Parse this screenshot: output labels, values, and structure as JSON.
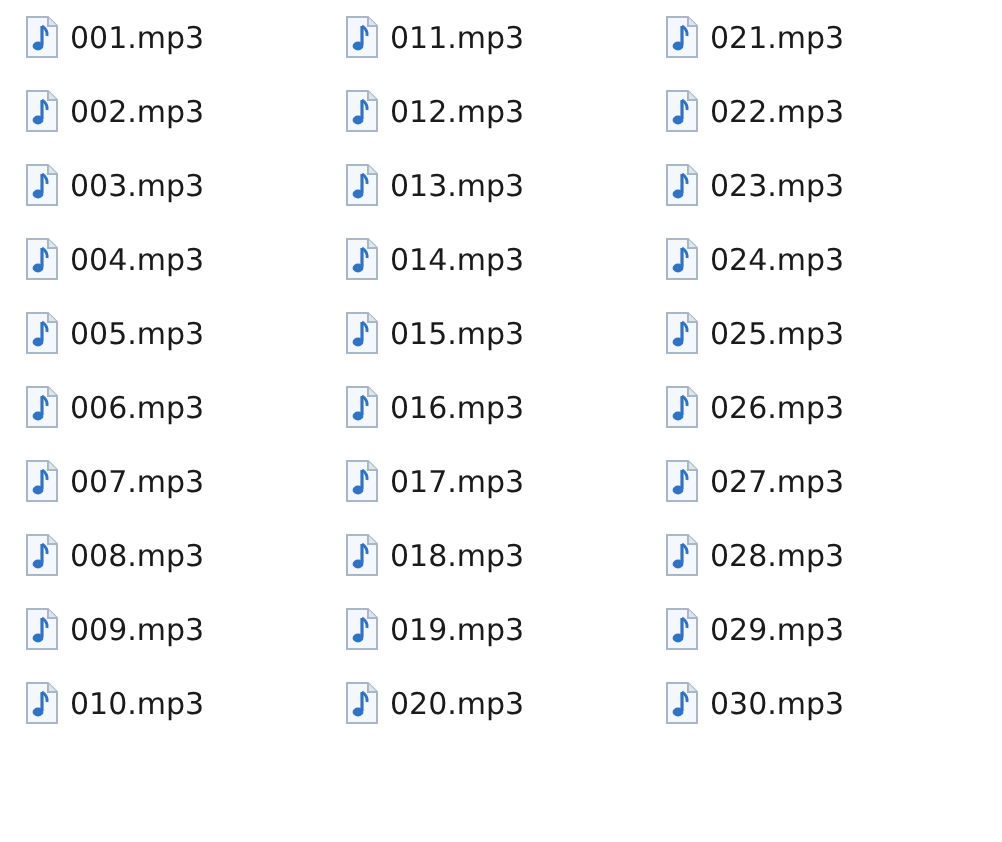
{
  "columns": [
    {
      "files": [
        "001.mp3",
        "002.mp3",
        "003.mp3",
        "004.mp3",
        "005.mp3",
        "006.mp3",
        "007.mp3",
        "008.mp3",
        "009.mp3",
        "010.mp3"
      ]
    },
    {
      "files": [
        "011.mp3",
        "012.mp3",
        "013.mp3",
        "014.mp3",
        "015.mp3",
        "016.mp3",
        "017.mp3",
        "018.mp3",
        "019.mp3",
        "020.mp3"
      ]
    },
    {
      "files": [
        "021.mp3",
        "022.mp3",
        "023.mp3",
        "024.mp3",
        "025.mp3",
        "026.mp3",
        "027.mp3",
        "028.mp3",
        "029.mp3",
        "030.mp3"
      ]
    }
  ]
}
